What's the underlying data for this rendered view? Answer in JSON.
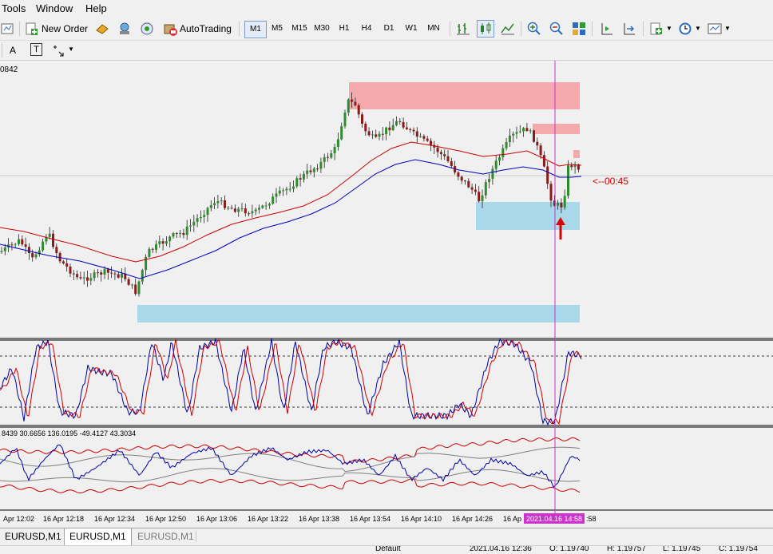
{
  "menu": {
    "tools": "Tools",
    "window": "Window",
    "help": "Help"
  },
  "toolbar": {
    "new_order": "New Order",
    "autotrading": "AutoTrading",
    "timeframes": [
      "M1",
      "M5",
      "M15",
      "M30",
      "H1",
      "H4",
      "D1",
      "W1",
      "MN"
    ],
    "active_timeframe": "M1"
  },
  "drawing_toolbar": {
    "text_tool": "A",
    "label_tool": "T"
  },
  "chart": {
    "price_label": "0842",
    "countdown": "<--00:45",
    "indicator_values": "8439 30.6656 136.0195 -49.4127 43.3034",
    "time_labels": [
      "Apr 12:02",
      "16 Apr 12:18",
      "16 Apr 12:34",
      "16 Apr 12:50",
      "16 Apr 13:06",
      "16 Apr 13:22",
      "16 Apr 13:38",
      "16 Apr 13:54",
      "16 Apr 14:10",
      "16 Apr 14:26",
      "16 Ap"
    ],
    "cursor_time": "2021.04.16 14:58",
    "cursor_time_suffix": ":58"
  },
  "tabs": [
    "EURUSD,M1",
    "EURUSD,M1",
    "EURUSD,M1"
  ],
  "status": {
    "profile": "Default",
    "datetime": "2021.04.16 12:36",
    "open": "O: 1.19740",
    "high": "H: 1.19757",
    "low": "L: 1.19745",
    "close": "C: 1.19754"
  },
  "colors": {
    "bull": "#2e8b2e",
    "bear": "#8b1a1a",
    "ma_red": "#cc0000",
    "ma_blue": "#0000bb",
    "supply_zone": "#f4a9ad",
    "demand_zone": "#a8d8ea",
    "cursor_line": "#cc33cc"
  }
}
